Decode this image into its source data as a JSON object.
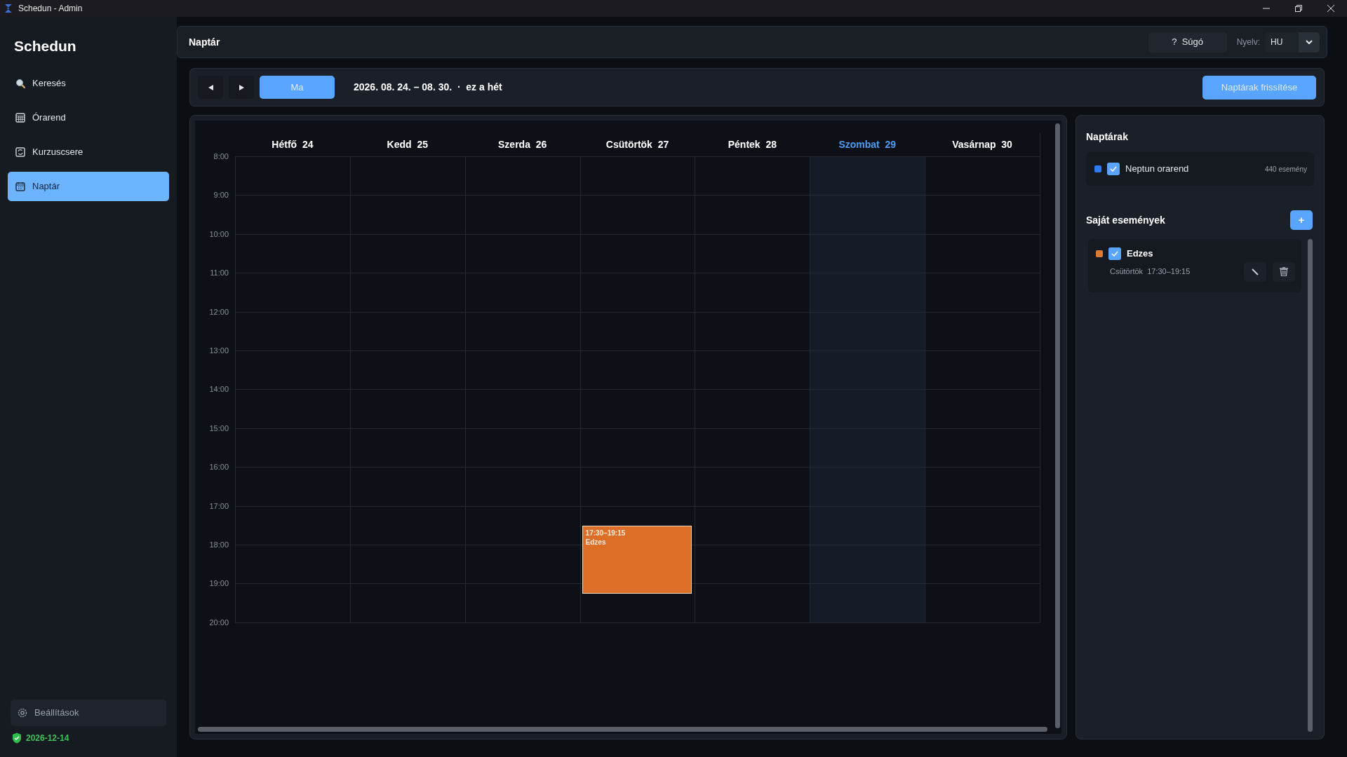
{
  "window": {
    "title": "Schedun - Admin"
  },
  "sidebar": {
    "app_name": "Schedun",
    "items": [
      {
        "label": "Keresés",
        "kind": "search",
        "selected": false
      },
      {
        "label": "Órarend",
        "kind": "timetable",
        "selected": false
      },
      {
        "label": "Kurzuscsere",
        "kind": "swap",
        "selected": false
      },
      {
        "label": "Naptár",
        "kind": "calendar",
        "selected": true
      }
    ],
    "settings": "Beállítások",
    "license_date": "2026-12-14"
  },
  "header": {
    "title": "Naptár",
    "help": "?  Súgó",
    "language_label": "Nyelv:",
    "language_value": "HU"
  },
  "toolbar": {
    "today": "Ma",
    "range": "2026. 08. 24. – 08. 30.  ·  ez a hét",
    "refresh": "Naptárak frissítése"
  },
  "calendar": {
    "hours": [
      "8:00",
      "9:00",
      "10:00",
      "11:00",
      "12:00",
      "13:00",
      "14:00",
      "15:00",
      "16:00",
      "17:00",
      "18:00",
      "19:00",
      "20:00"
    ],
    "days": [
      {
        "name": "Hétfő  24",
        "selected": false
      },
      {
        "name": "Kedd  25",
        "selected": false
      },
      {
        "name": "Szerda  26",
        "selected": false
      },
      {
        "name": "Csütörtök  27",
        "selected": false,
        "events": [
          {
            "time": "17:30–19:15",
            "title": "Edzes",
            "color": "#dc6e28"
          }
        ]
      },
      {
        "name": "Péntek  28",
        "selected": false
      },
      {
        "name": "Szombat  29",
        "selected": true
      },
      {
        "name": "Vasárnap  30",
        "selected": false
      }
    ]
  },
  "calendars": {
    "title": "Naptárak",
    "items": [
      {
        "name": "Neptun orarend",
        "count": "440 esemény",
        "color": "#2f7bf0",
        "checked": true
      }
    ]
  },
  "own_events": {
    "title": "Saját események",
    "add": "+",
    "items": [
      {
        "title": "Edzes",
        "schedule": "Csütörtök  17:30–19:15",
        "color": "#e07a30",
        "checked": true
      }
    ]
  }
}
